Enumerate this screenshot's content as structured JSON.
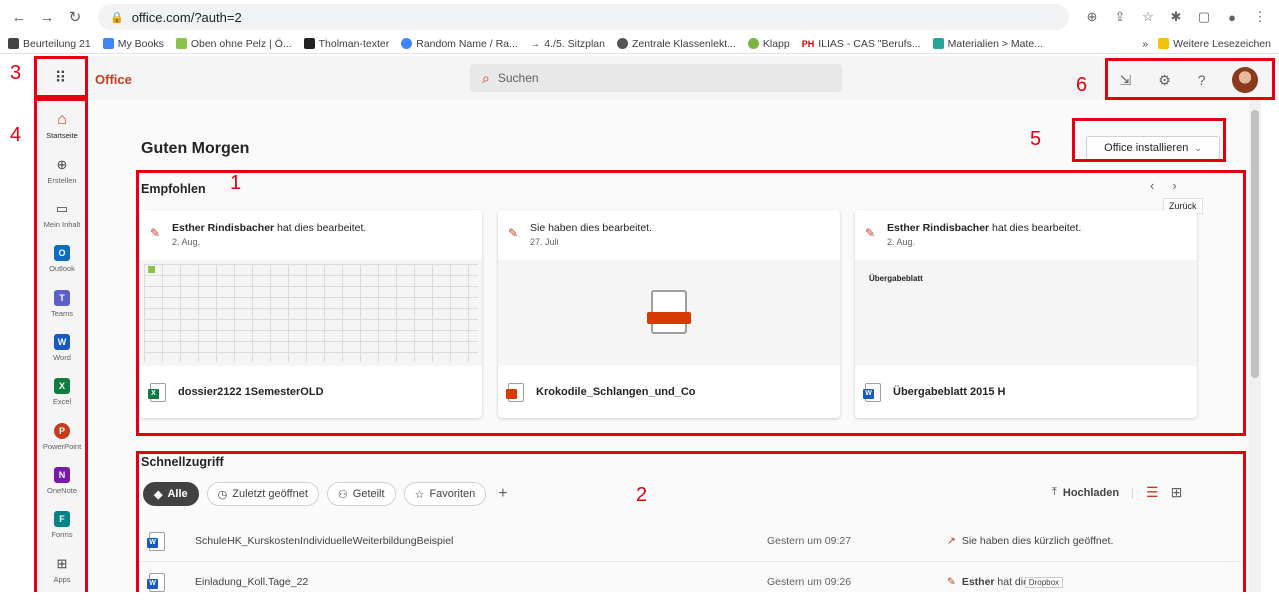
{
  "browser": {
    "url": "office.com/?auth=2",
    "bookmarks": [
      "Beurteilung 21",
      "My Books",
      "Oben ohne Pelz | Ö...",
      "Tholman-texter",
      "Random Name / Ra...",
      "4./5. Sitzplan",
      "Zentrale Klassenlekt...",
      "Klapp",
      "ILIAS - CAS \"Berufs...",
      "Materialien > Mate..."
    ],
    "bookmarks_overflow": "»",
    "other_bookmarks": "Weitere Lesezeichen"
  },
  "header": {
    "brand": "Office",
    "search_placeholder": "Suchen"
  },
  "rail": [
    {
      "label": "Startseite"
    },
    {
      "label": "Erstellen"
    },
    {
      "label": "Mein Inhalt"
    },
    {
      "label": "Outlook",
      "color": "#0f6cbd",
      "glyph": "O"
    },
    {
      "label": "Teams",
      "color": "#5b5fc7",
      "glyph": "T"
    },
    {
      "label": "Word",
      "color": "#185abd",
      "glyph": "W"
    },
    {
      "label": "Excel",
      "color": "#107c41",
      "glyph": "X"
    },
    {
      "label": "PowerPoint",
      "color": "#c43e1c",
      "glyph": "P"
    },
    {
      "label": "OneNote",
      "color": "#7719aa",
      "glyph": "N"
    },
    {
      "label": "Forms",
      "color": "#038387",
      "glyph": "F"
    },
    {
      "label": "Apps"
    }
  ],
  "main": {
    "greeting": "Guten Morgen",
    "install_label": "Office installieren",
    "recommended_title": "Empfohlen",
    "back_tooltip": "Zurück",
    "cards": [
      {
        "who": "Esther Rindisbacher",
        "action": " hat dies bearbeitet.",
        "date": "2. Aug.",
        "file": "dossier2122 1SemesterOLD",
        "type": "excel"
      },
      {
        "who": "",
        "action": "Sie haben dies bearbeitet.",
        "date": "27. Juli",
        "file": "Krokodile_Schlangen_und_Co",
        "type": "pdf"
      },
      {
        "who": "Esther Rindisbacher",
        "action": " hat dies bearbeitet.",
        "date": "2. Aug.",
        "file": "Übergabeblatt 2015 H",
        "type": "word",
        "preview_text": "Übergabeblatt"
      }
    ],
    "quick_title": "Schnellzugriff",
    "filters": [
      "Alle",
      "Zuletzt geöffnet",
      "Geteilt",
      "Favoriten"
    ],
    "upload_label": "Hochladen",
    "rows": [
      {
        "name": "SchuleHK_KurskostenIndividuelleWeiterbildungBeispiel",
        "time": "Gestern um 09:27",
        "activity": "Sie haben dies kürzlich geöffnet.",
        "who": ""
      },
      {
        "name": "Einladung_Koll.Tage_22",
        "time": "Gestern um 09:26",
        "activity": " hat dies be",
        "who": "Esther",
        "overlay": "Dropbox"
      }
    ]
  },
  "annotations": [
    "1",
    "2",
    "3",
    "4",
    "5",
    "6"
  ],
  "accent": "#c43e1c",
  "annotation_color": "#e3000f"
}
